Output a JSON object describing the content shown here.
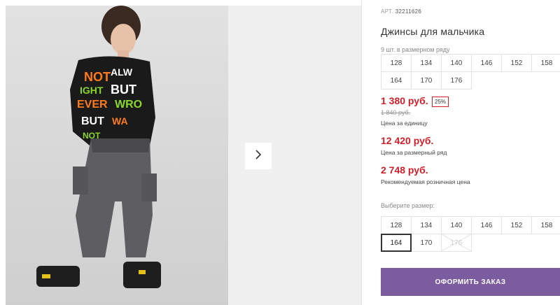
{
  "product": {
    "art_label": "АРТ.",
    "art_value": "32211626",
    "title": "Джинсы для мальчика",
    "pack_info": "9 шт. в размерном ряду"
  },
  "pack_sizes": [
    "128",
    "134",
    "140",
    "146",
    "152",
    "158",
    "164",
    "170",
    "176"
  ],
  "pricing": {
    "price": "1 380 руб.",
    "discount": "25%",
    "old_price": "1 840 руб.",
    "unit_label": "Цена за единицу",
    "row_price": "12 420 руб.",
    "row_label": "Цена за размерный ряд",
    "retail_price": "2 748 руб.",
    "retail_label": "Рекомендуемая розничная цена"
  },
  "size_select": {
    "label": "Выберите размер:",
    "sizes": [
      "128",
      "134",
      "140",
      "146",
      "152",
      "158",
      "164",
      "170",
      "176"
    ],
    "selected": "164",
    "disabled": "176"
  },
  "actions": {
    "order_label": "ОФОРМИТЬ ЗАКАЗ"
  },
  "colors": {
    "price_red": "#d11f2a",
    "button_purple": "#7b5d9f"
  }
}
